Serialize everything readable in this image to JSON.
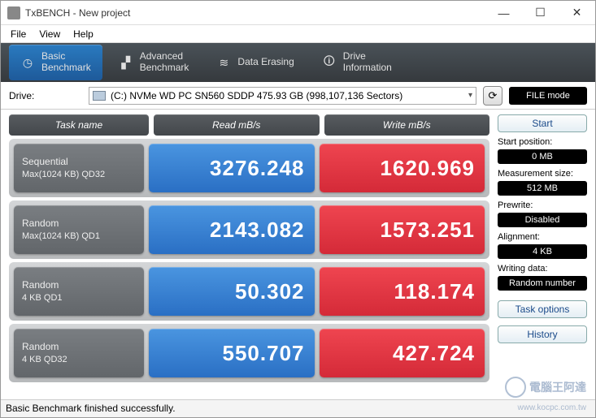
{
  "window": {
    "title": "TxBENCH - New project"
  },
  "menu": {
    "file": "File",
    "view": "View",
    "help": "Help"
  },
  "tabs": {
    "basic": "Basic\nBenchmark",
    "advanced": "Advanced\nBenchmark",
    "erase": "Data Erasing",
    "drive": "Drive\nInformation"
  },
  "drive": {
    "label": "Drive:",
    "selected": "(C:) NVMe WD PC SN560 SDDP  475.93 GB (998,107,136 Sectors)",
    "file_mode": "FILE mode"
  },
  "headers": {
    "task": "Task name",
    "read": "Read mB/s",
    "write": "Write mB/s"
  },
  "rows": [
    {
      "t1": "Sequential",
      "t2": "Max(1024 KB) QD32",
      "read": "3276.248",
      "write": "1620.969"
    },
    {
      "t1": "Random",
      "t2": "Max(1024 KB) QD1",
      "read": "2143.082",
      "write": "1573.251"
    },
    {
      "t1": "Random",
      "t2": "4 KB QD1",
      "read": "50.302",
      "write": "118.174"
    },
    {
      "t1": "Random",
      "t2": "4 KB QD32",
      "read": "550.707",
      "write": "427.724"
    }
  ],
  "side": {
    "start": "Start",
    "start_pos_label": "Start position:",
    "start_pos": "0 MB",
    "meas_label": "Measurement size:",
    "meas": "512 MB",
    "prewrite_label": "Prewrite:",
    "prewrite": "Disabled",
    "align_label": "Alignment:",
    "align": "4 KB",
    "wdata_label": "Writing data:",
    "wdata": "Random number",
    "task_opts": "Task options",
    "history": "History"
  },
  "status": "Basic Benchmark finished successfully.",
  "watermark": {
    "text": "電腦王阿達",
    "url": "www.kocpc.com.tw"
  }
}
